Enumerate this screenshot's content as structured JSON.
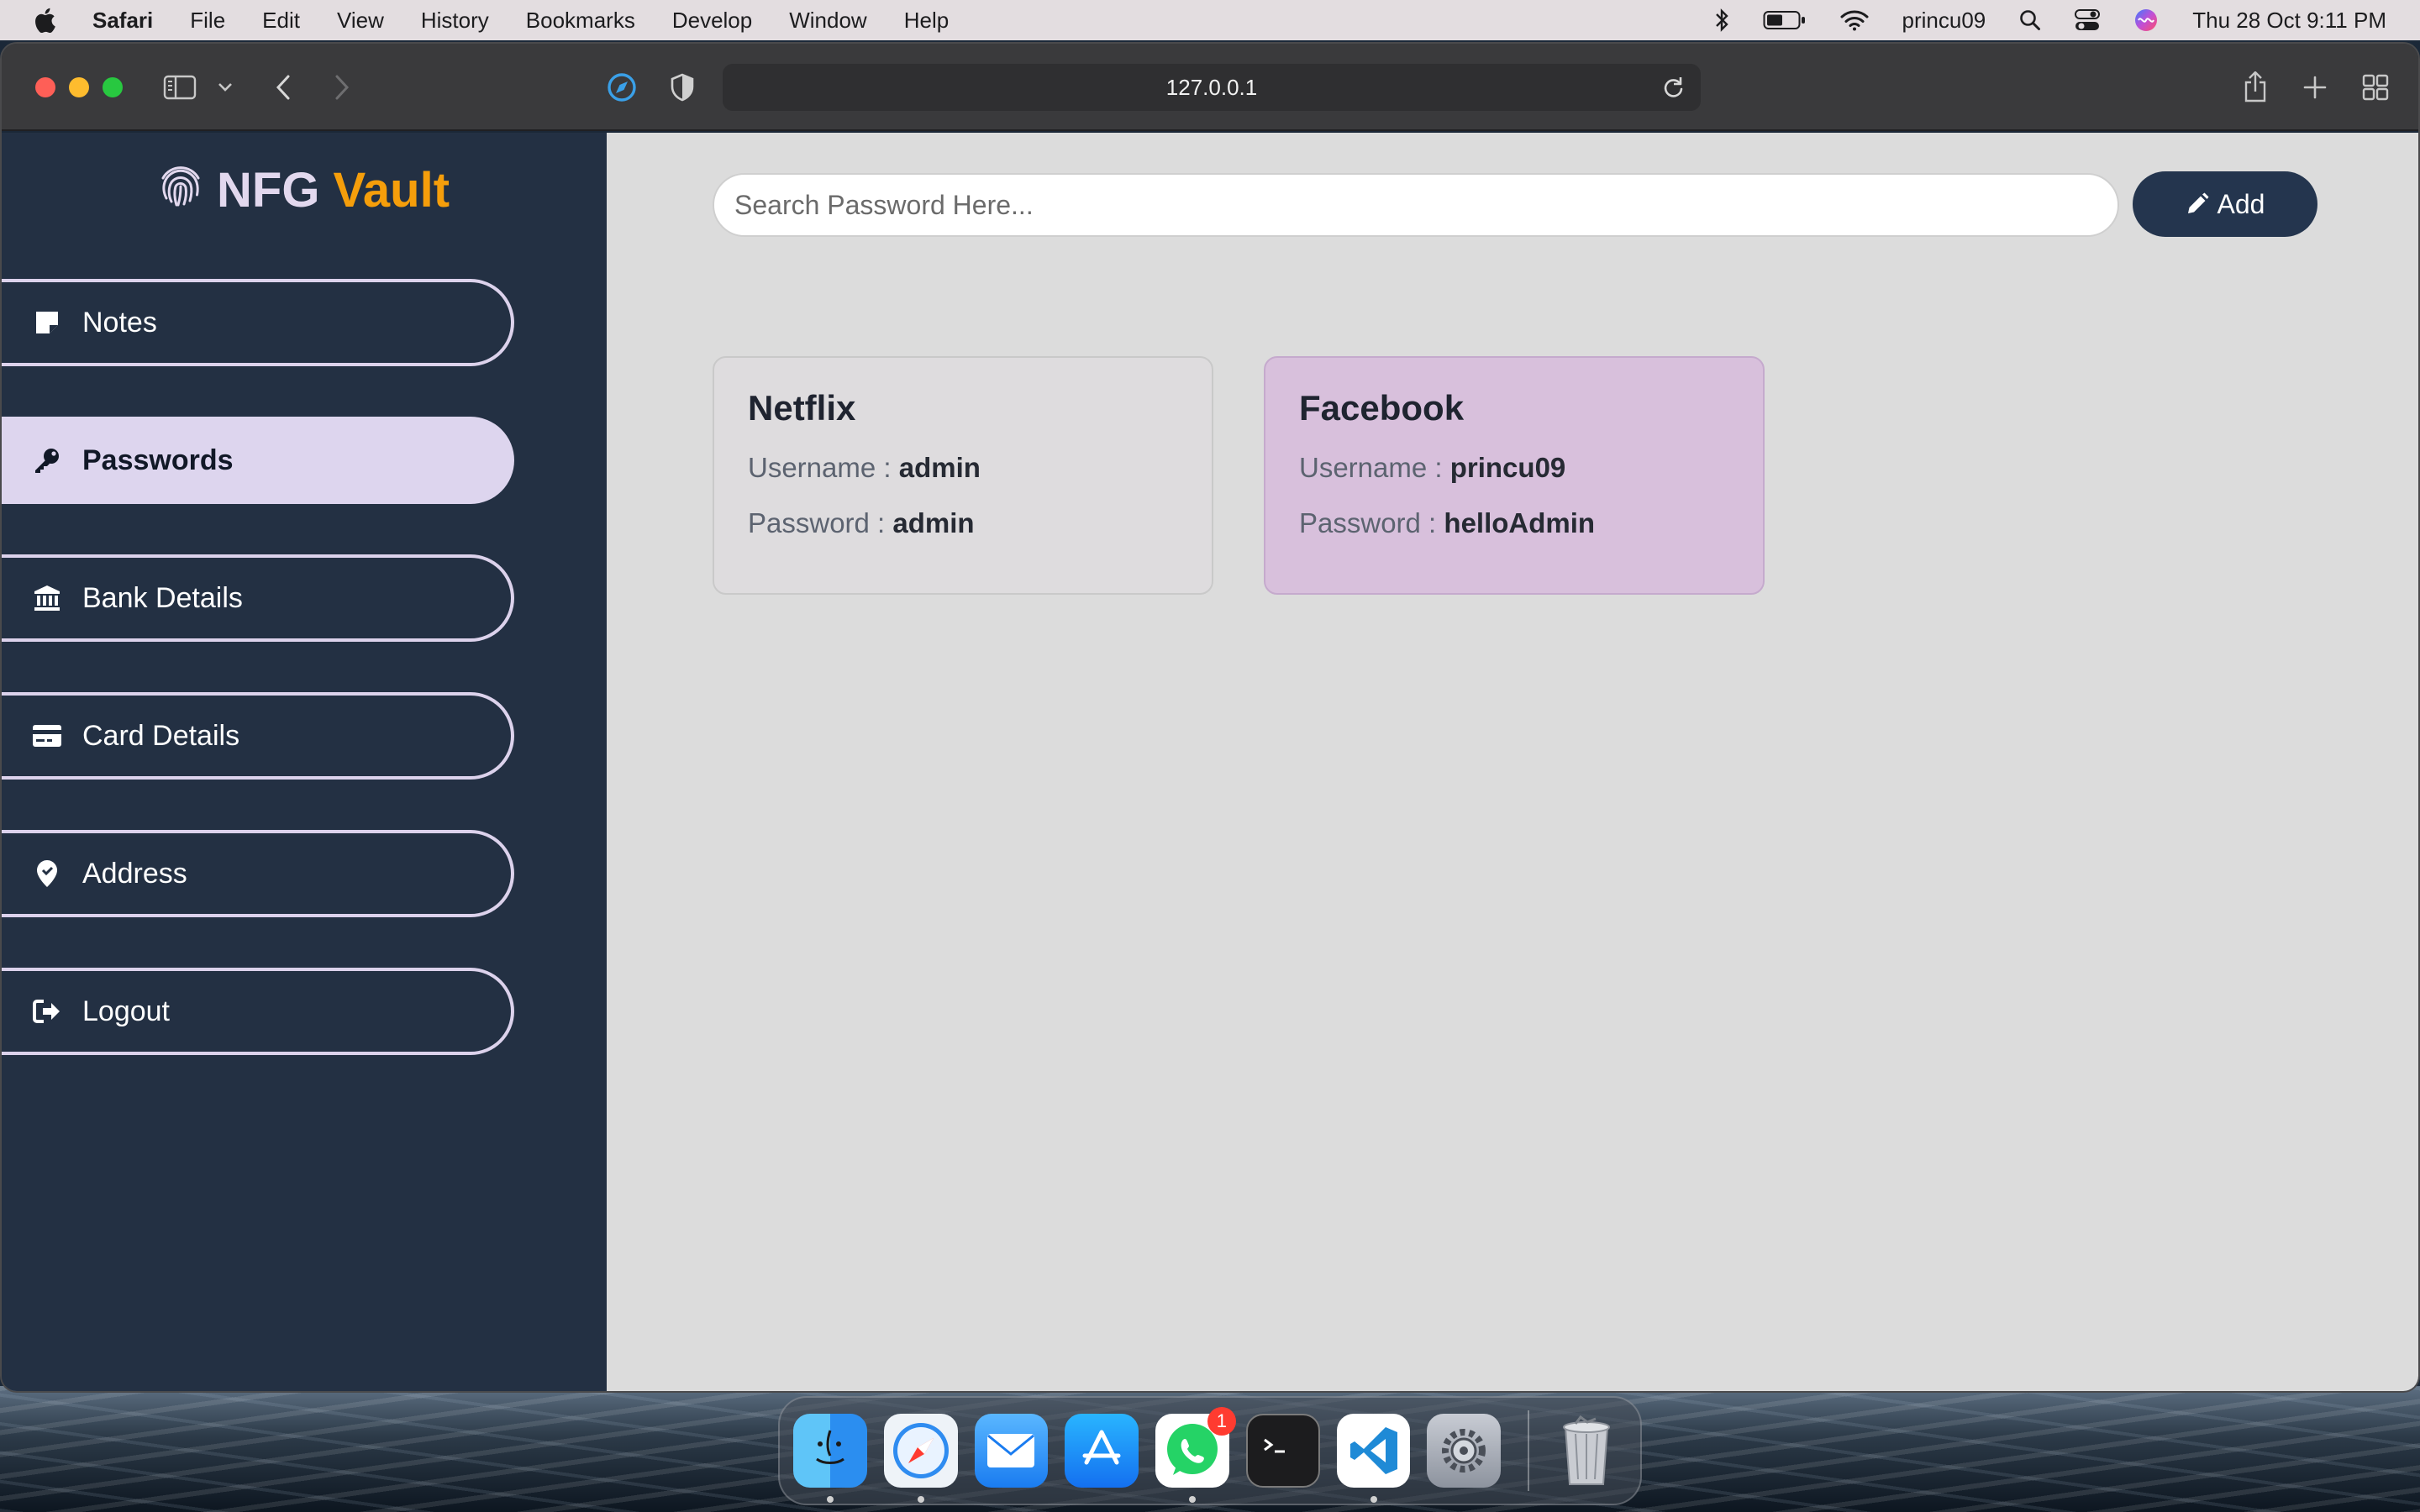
{
  "menubar": {
    "app_name": "Safari",
    "menus": [
      "File",
      "Edit",
      "View",
      "History",
      "Bookmarks",
      "Develop",
      "Window",
      "Help"
    ],
    "username": "princu09",
    "datetime": "Thu 28 Oct  9:11 PM"
  },
  "browser": {
    "url": "127.0.0.1"
  },
  "brand": {
    "first": "NFG",
    "second": "Vault",
    "accent_color": "#f59e0b"
  },
  "sidebar": {
    "items": [
      {
        "label": "Notes",
        "icon": "note-icon",
        "active": false
      },
      {
        "label": "Passwords",
        "icon": "key-icon",
        "active": true
      },
      {
        "label": "Bank Details",
        "icon": "bank-icon",
        "active": false
      },
      {
        "label": "Card Details",
        "icon": "credit-card-icon",
        "active": false
      },
      {
        "label": "Address",
        "icon": "map-pin-icon",
        "active": false
      },
      {
        "label": "Logout",
        "icon": "logout-icon",
        "active": false
      }
    ]
  },
  "search": {
    "placeholder": "Search Password Here...",
    "value": ""
  },
  "add_button": {
    "label": "Add",
    "color": "#24354e"
  },
  "cards": [
    {
      "title": "Netflix",
      "username_label": "Username :",
      "username": "admin",
      "password_label": "Password :",
      "password": "admin",
      "color": "#dedcde"
    },
    {
      "title": "Facebook",
      "username_label": "Username :",
      "username": "princu09",
      "password_label": "Password :",
      "password": "helloAdmin",
      "color": "#d8c0dc"
    }
  ],
  "dock": {
    "apps": [
      "Finder",
      "Safari",
      "Mail",
      "App Store",
      "WhatsApp",
      "Terminal",
      "Visual Studio Code",
      "System Preferences",
      "Trash"
    ],
    "whatsapp_badge": "1"
  }
}
